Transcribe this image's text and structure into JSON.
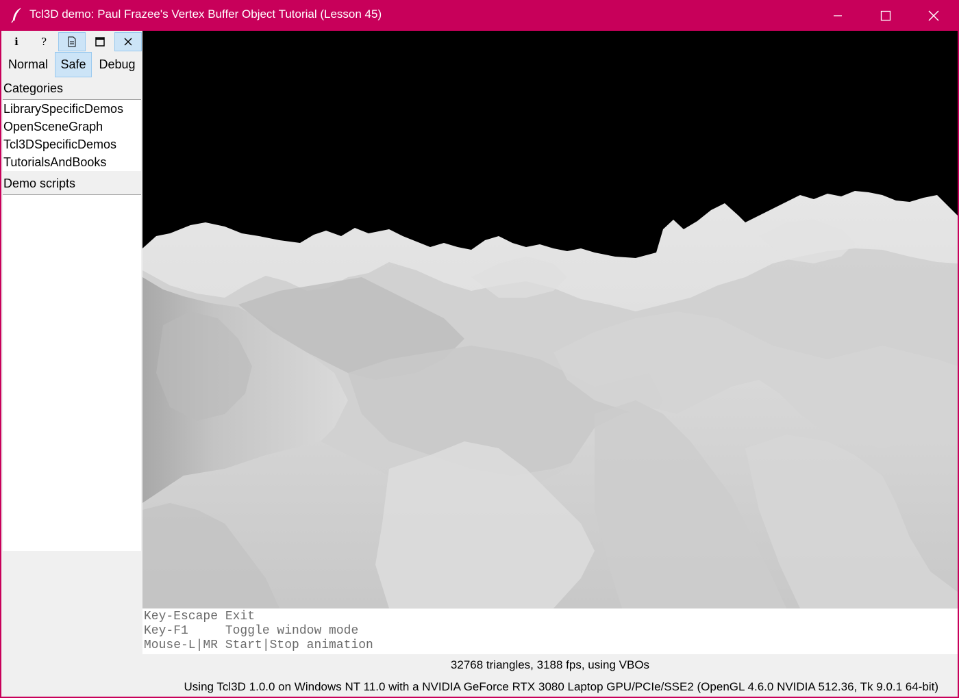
{
  "window": {
    "title": "Tcl3D demo: Paul Frazee's Vertex Buffer Object Tutorial (Lesson 45)",
    "title_bar_color": "#c8005a"
  },
  "toolbar": {
    "buttons": [
      {
        "icon": "info-icon",
        "glyph": "i"
      },
      {
        "icon": "help-icon",
        "glyph": "?"
      },
      {
        "icon": "document-icon"
      },
      {
        "icon": "maximize-icon"
      },
      {
        "icon": "close-icon"
      }
    ]
  },
  "modes": {
    "normal": "Normal",
    "safe": "Safe",
    "debug": "Debug",
    "selected": "Safe"
  },
  "categories": {
    "label": "Categories",
    "items": [
      "LibrarySpecificDemos",
      "OpenSceneGraph",
      "Tcl3DSpecificDemos",
      "TutorialsAndBooks"
    ]
  },
  "demo_scripts": {
    "label": "Demo scripts",
    "items": []
  },
  "info": {
    "lines": [
      "Key-Escape Exit",
      "Key-F1     Toggle window mode",
      "Mouse-L|MR Start|Stop animation"
    ]
  },
  "status": {
    "stats": "32768 triangles, 3188 fps, using VBOs",
    "version": "Using Tcl3D 1.0.0 on Windows NT 11.0 with a NVIDIA GeForce RTX 3080 Laptop GPU/PCIe/SSE2 (OpenGL 4.6.0 NVIDIA 512.36, Tk 9.0.1 64-bit)"
  }
}
